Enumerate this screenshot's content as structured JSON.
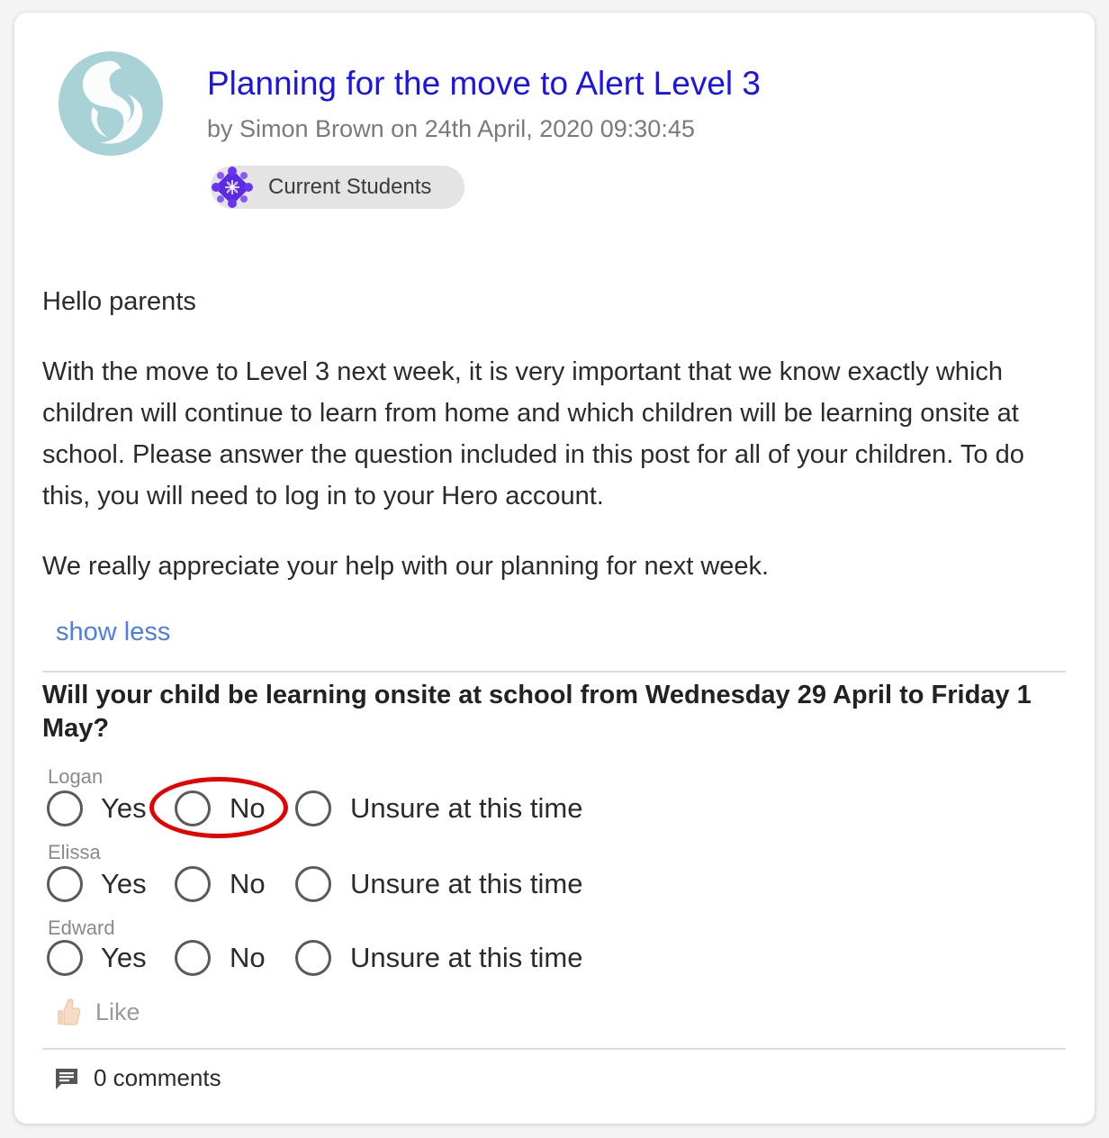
{
  "post": {
    "title": "Planning for the move to Alert Level 3",
    "byline": "by Simon Brown on 24th April, 2020 09:30:45",
    "group_tag": "Current Students",
    "logo_icon": "school-swirl-logo",
    "body": [
      "Hello parents",
      "With the move to Level 3 next week, it is very important that we know exactly which children will continue to learn from home and which children will be learning onsite at school. Please answer the question included in this post for all of your children. To do this, you will need to log in to your Hero account.",
      "We really appreciate your help with our planning for next week."
    ],
    "show_less": "show less"
  },
  "poll": {
    "question": "Will your child be learning onsite at school from Wednesday 29 April to Friday 1 May?",
    "options": [
      "Yes",
      "No",
      "Unsure at this time"
    ],
    "children": [
      {
        "name": "Logan",
        "selected": null
      },
      {
        "name": "Elissa",
        "selected": null
      },
      {
        "name": "Edward",
        "selected": null
      }
    ],
    "annotation": "red ellipse around Logan's No option"
  },
  "footer": {
    "like_label": "Like",
    "like_icon": "thumbs-up-icon",
    "comments_label": "0 comments",
    "comments_icon": "comment-icon"
  },
  "colors": {
    "title": "#1a14e6",
    "link": "#4a7fe8",
    "annotation": "#e60000",
    "logo": "#a9d2d6"
  }
}
